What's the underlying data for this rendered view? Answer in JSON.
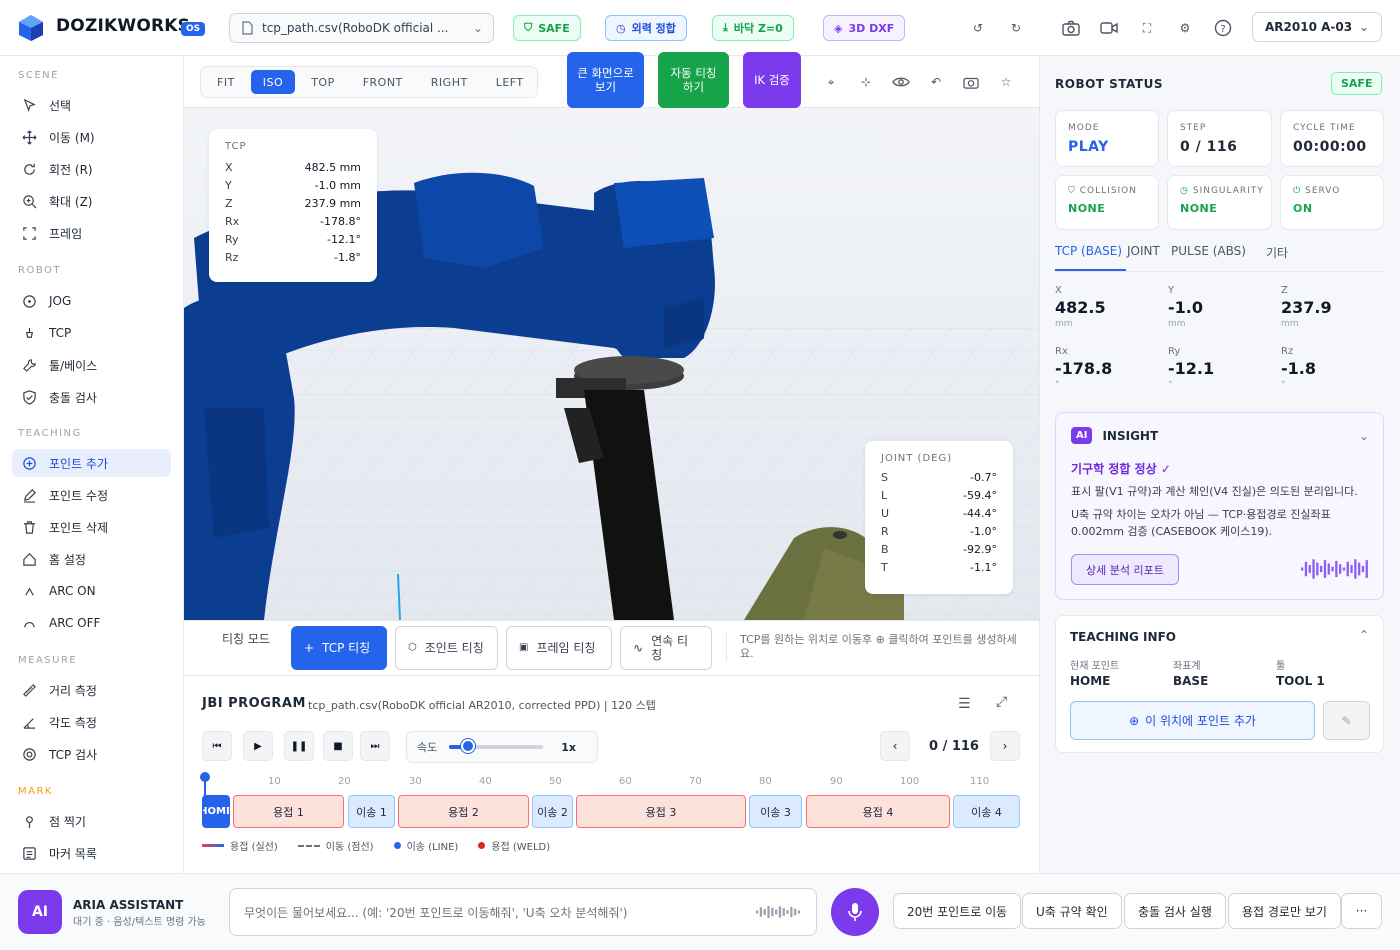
{
  "app": {
    "brand": "DOZIKWORKS",
    "badge": "OS",
    "file": "tcp_path.csv(RoboDK official ...",
    "robot": "AR2010 A-03"
  },
  "status_pills": {
    "safe": "SAFE",
    "fk": "외력 정합",
    "floor": "바닥 Z=0",
    "dxf": "3D DXF"
  },
  "sidebar": {
    "scene_title": "SCENE",
    "scene": [
      "선택",
      "이동 (M)",
      "회전 (R)",
      "확대 (Z)",
      "프레임"
    ],
    "robot_title": "ROBOT",
    "robot": [
      "JOG",
      "TCP",
      "툴/베이스",
      "충돌 검사"
    ],
    "teaching_title": "TEACHING",
    "teaching": [
      "포인트 추가",
      "포인트 수정",
      "포인트 삭제",
      "홈 설정",
      "ARC ON",
      "ARC OFF"
    ],
    "measure_title": "MEASURE",
    "measure": [
      "거리 측정",
      "각도 측정",
      "TCP 검사"
    ],
    "mark_title": "MARK",
    "mark": [
      "점 찍기",
      "마커 목록"
    ]
  },
  "views": [
    "FIT",
    "ISO",
    "TOP",
    "FRONT",
    "RIGHT",
    "LEFT"
  ],
  "view_active": "ISO",
  "actions": {
    "fullscreen": "큰 화면으로 보기",
    "auto_teach": "자동 티칭 하기",
    "ik": "IK 검증"
  },
  "tcp_overlay": {
    "title": "TCP",
    "rows": [
      [
        "X",
        "482.5 mm"
      ],
      [
        "Y",
        "-1.0 mm"
      ],
      [
        "Z",
        "237.9 mm"
      ],
      [
        "Rx",
        "-178.8°"
      ],
      [
        "Ry",
        "-12.1°"
      ],
      [
        "Rz",
        "-1.8°"
      ]
    ]
  },
  "joint_overlay": {
    "title": "JOINT (DEG)",
    "rows": [
      [
        "S",
        "-0.7°"
      ],
      [
        "L",
        "-59.4°"
      ],
      [
        "U",
        "-44.4°"
      ],
      [
        "R",
        "-1.0°"
      ],
      [
        "B",
        "-92.9°"
      ],
      [
        "T",
        "-1.1°"
      ]
    ]
  },
  "teach_modes": {
    "label": "티칭 모드",
    "tcp": "TCP 티칭",
    "joint": "조인트 티칭",
    "frame": "프레임 티칭",
    "continuous": "연속 티칭",
    "hint": "TCP를 원하는 위치로 이동후 ⊕ 클릭하여 포인트를 생성하세요."
  },
  "program": {
    "title": "JBI PROGRAM",
    "desc": "tcp_path.csv(RoboDK official AR2010, corrected PPD) | 120 스텝",
    "speed_label": "속도",
    "speed_value": "1x",
    "speed": 0.2,
    "counter": "0 / 116",
    "ticks": [
      "10",
      "20",
      "30",
      "40",
      "50",
      "60",
      "70",
      "80",
      "90",
      "100",
      "110"
    ],
    "segments": [
      {
        "label": "HOME",
        "type": "home"
      },
      {
        "label": "용접 1",
        "type": "weld"
      },
      {
        "label": "이송 1",
        "type": "move"
      },
      {
        "label": "용접 2",
        "type": "weld"
      },
      {
        "label": "이송 2",
        "type": "move"
      },
      {
        "label": "용접 3",
        "type": "weld"
      },
      {
        "label": "이송 3",
        "type": "move"
      },
      {
        "label": "용접 4",
        "type": "weld"
      },
      {
        "label": "이송 4",
        "type": "move"
      }
    ],
    "legend": [
      "용접 (실선)",
      "이동 (점선)",
      "이송 (LINE)",
      "용접 (WELD)"
    ]
  },
  "robot_status": {
    "title": "ROBOT STATUS",
    "safe": "SAFE",
    "mode_lbl": "MODE",
    "mode": "PLAY",
    "step_lbl": "STEP",
    "step": "0 / 116",
    "cycle_lbl": "CYCLE TIME",
    "cycle": "00:00:00",
    "collision_lbl": "COLLISION",
    "collision": "NONE",
    "sing_lbl": "SINGULARITY",
    "sing": "NONE",
    "servo_lbl": "SERVO",
    "servo": "ON"
  },
  "coord_tabs": [
    "TCP (BASE)",
    "JOINT",
    "PULSE (ABS)",
    "기타"
  ],
  "coords": [
    {
      "l": "X",
      "v": "482.5",
      "u": "mm"
    },
    {
      "l": "Y",
      "v": "-1.0",
      "u": "mm"
    },
    {
      "l": "Z",
      "v": "237.9",
      "u": "mm"
    },
    {
      "l": "Rx",
      "v": "-178.8",
      "u": "°"
    },
    {
      "l": "Ry",
      "v": "-12.1",
      "u": "°"
    },
    {
      "l": "Rz",
      "v": "-1.8",
      "u": "°"
    }
  ],
  "insight": {
    "badge": "AI",
    "title": "INSIGHT",
    "headline": "기구학 정합 정상 ✓",
    "p1": "표시 팔(V1 규약)과 계산 체인(V4 진실)은 의도된 분리입니다.",
    "p2": "U축 규약 차이는 오차가 아님 — TCP·용접경로 진실좌표 0.002mm 검증 (CASEBOOK 케이스19).",
    "button": "상세 분석 리포트"
  },
  "teaching_info": {
    "title": "TEACHING INFO",
    "point_lbl": "현재 포인트",
    "point": "HOME",
    "frame_lbl": "좌표계",
    "frame": "BASE",
    "tool_lbl": "툴",
    "tool": "TOOL 1",
    "add_button": "이 위치에 포인트 추가"
  },
  "assistant": {
    "badge": "AI",
    "name": "ARIA ASSISTANT",
    "status": "대기 중 · 음성/텍스트 명령 가능",
    "placeholder": "무엇이든 물어보세요... (예: '20번 포인트로 이동해줘', 'U축 오차 분석해줘')",
    "quick": [
      "20번 포인트로 이동",
      "U축 규약 확인",
      "충돌 검사 실행",
      "용접 경로만 보기"
    ],
    "more": "···"
  },
  "colors": {
    "accent": "#2563eb",
    "safe": "#16a34a",
    "robot": "#0b3d91",
    "auto": "#16a34a",
    "ik": "#7c3aed"
  }
}
